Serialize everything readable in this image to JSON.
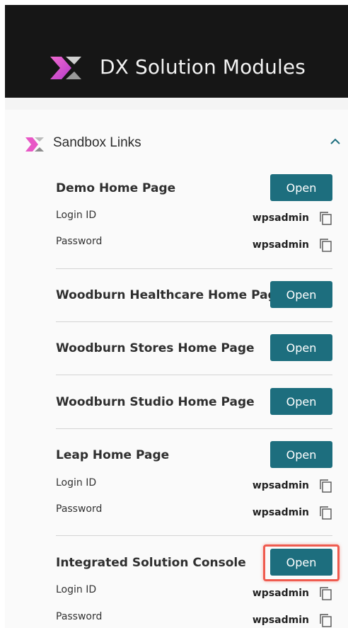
{
  "header": {
    "title": "DX Solution Modules"
  },
  "section": {
    "title": "Sandbox Links",
    "expanded": true
  },
  "open_label": "Open",
  "items": [
    {
      "title": "Demo Home Page",
      "login_label": "Login ID",
      "login_value": "wpsadmin",
      "password_label": "Password",
      "password_value": "wpsadmin"
    },
    {
      "title": "Woodburn Healthcare Home Page"
    },
    {
      "title": "Woodburn Stores Home Page"
    },
    {
      "title": "Woodburn Studio Home Page"
    },
    {
      "title": "Leap Home Page",
      "login_label": "Login ID",
      "login_value": "wpsadmin",
      "password_label": "Password",
      "password_value": "wpsadmin"
    },
    {
      "title": "Integrated Solution Console",
      "login_label": "Login ID",
      "login_value": "wpsadmin",
      "password_label": "Password",
      "password_value": "wpsadmin"
    }
  ],
  "colors": {
    "header_bg": "#161616",
    "button": "#1d6e7e",
    "highlight": "#ef5b4f",
    "accent_pink": "#e33fa8"
  },
  "icons": {
    "logo": "x-logo-icon",
    "collapse": "chevron-up-icon",
    "copy": "copy-icon"
  }
}
